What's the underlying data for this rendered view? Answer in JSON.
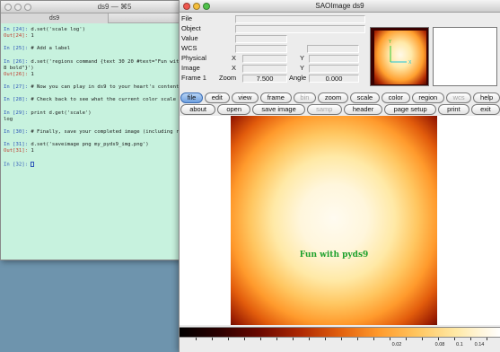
{
  "terminal": {
    "title": "ds9 — ⌘5",
    "tab_label": "ds9",
    "lines": [
      {
        "text": "In [24]: d.set('scale log')",
        "type": "in"
      },
      {
        "text": "Out[24]: 1",
        "type": "out"
      },
      {
        "text": "",
        "type": "gap"
      },
      {
        "text": "In [25]: # Add a label",
        "type": "in"
      },
      {
        "text": "",
        "type": "gap"
      },
      {
        "text": "In [26]: d.set('regions command {text 30 20 #text=\"Fun wit",
        "type": "in"
      },
      {
        "text": "8 bold\"}')",
        "type": "plain"
      },
      {
        "text": "Out[26]: 1",
        "type": "out"
      },
      {
        "text": "",
        "type": "gap"
      },
      {
        "text": "In [27]: # Now you can play in ds9 to your heart's content",
        "type": "in"
      },
      {
        "text": "",
        "type": "gap"
      },
      {
        "text": "In [28]: # Check back to see what the current color scale",
        "type": "in"
      },
      {
        "text": "",
        "type": "gap"
      },
      {
        "text": "In [29]: print d.get('scale')",
        "type": "in"
      },
      {
        "text": "log",
        "type": "plain"
      },
      {
        "text": "",
        "type": "gap"
      },
      {
        "text": "In [30]: # Finally, save your completed image (including re",
        "type": "in"
      },
      {
        "text": "",
        "type": "gap"
      },
      {
        "text": "In [31]: d.set('saveimage png my_pyds9_img.png')",
        "type": "in"
      },
      {
        "text": "Out[31]: 1",
        "type": "out"
      },
      {
        "text": "",
        "type": "gap"
      }
    ],
    "prompt": "In [32]: "
  },
  "ds9": {
    "title": "SAOImage ds9",
    "info": {
      "file_label": "File",
      "object_label": "Object",
      "value_label": "Value",
      "wcs_label": "WCS",
      "physical_label": "Physical",
      "image_label": "Image",
      "frame_label": "Frame 1",
      "x_label": "X",
      "y_label": "Y",
      "zoom_label": "Zoom",
      "zoom_value": "7.500",
      "angle_label": "Angle",
      "angle_value": "0.000"
    },
    "buttons_row1": [
      {
        "label": "file",
        "name": "file-button",
        "active": true,
        "disabled": false
      },
      {
        "label": "edit",
        "name": "edit-button",
        "active": false,
        "disabled": false
      },
      {
        "label": "view",
        "name": "view-button",
        "active": false,
        "disabled": false
      },
      {
        "label": "frame",
        "name": "frame-button",
        "active": false,
        "disabled": false
      },
      {
        "label": "bin",
        "name": "bin-button",
        "active": false,
        "disabled": true
      },
      {
        "label": "zoom",
        "name": "zoom-button",
        "active": false,
        "disabled": false
      },
      {
        "label": "scale",
        "name": "scale-button",
        "active": false,
        "disabled": false
      },
      {
        "label": "color",
        "name": "color-button",
        "active": false,
        "disabled": false
      },
      {
        "label": "region",
        "name": "region-button",
        "active": false,
        "disabled": false
      },
      {
        "label": "wcs",
        "name": "wcs-button",
        "active": false,
        "disabled": true
      },
      {
        "label": "help",
        "name": "help-button",
        "active": false,
        "disabled": false
      }
    ],
    "buttons_row2": [
      {
        "label": "about",
        "name": "about-button",
        "active": false,
        "disabled": false
      },
      {
        "label": "open",
        "name": "open-button",
        "active": false,
        "disabled": false
      },
      {
        "label": "save image",
        "name": "save-image-button",
        "active": false,
        "disabled": false
      },
      {
        "label": "samp",
        "name": "samp-button",
        "active": false,
        "disabled": true
      },
      {
        "label": "header",
        "name": "header-button",
        "active": false,
        "disabled": false
      },
      {
        "label": "page setup",
        "name": "page-setup-button",
        "active": false,
        "disabled": false
      },
      {
        "label": "print",
        "name": "print-button",
        "active": false,
        "disabled": false
      },
      {
        "label": "exit",
        "name": "exit-button",
        "active": false,
        "disabled": false
      }
    ],
    "image_label_text": "Fun with pyds9",
    "colorbar_ticks": [
      "0.02",
      "0.08",
      "0.1",
      "0.14"
    ],
    "colors": {
      "label_green": "#1fa12d",
      "active_button": "#6ea0e0",
      "compass_green": "#2ecc40",
      "compass_cyan": "#22c4d6"
    }
  }
}
